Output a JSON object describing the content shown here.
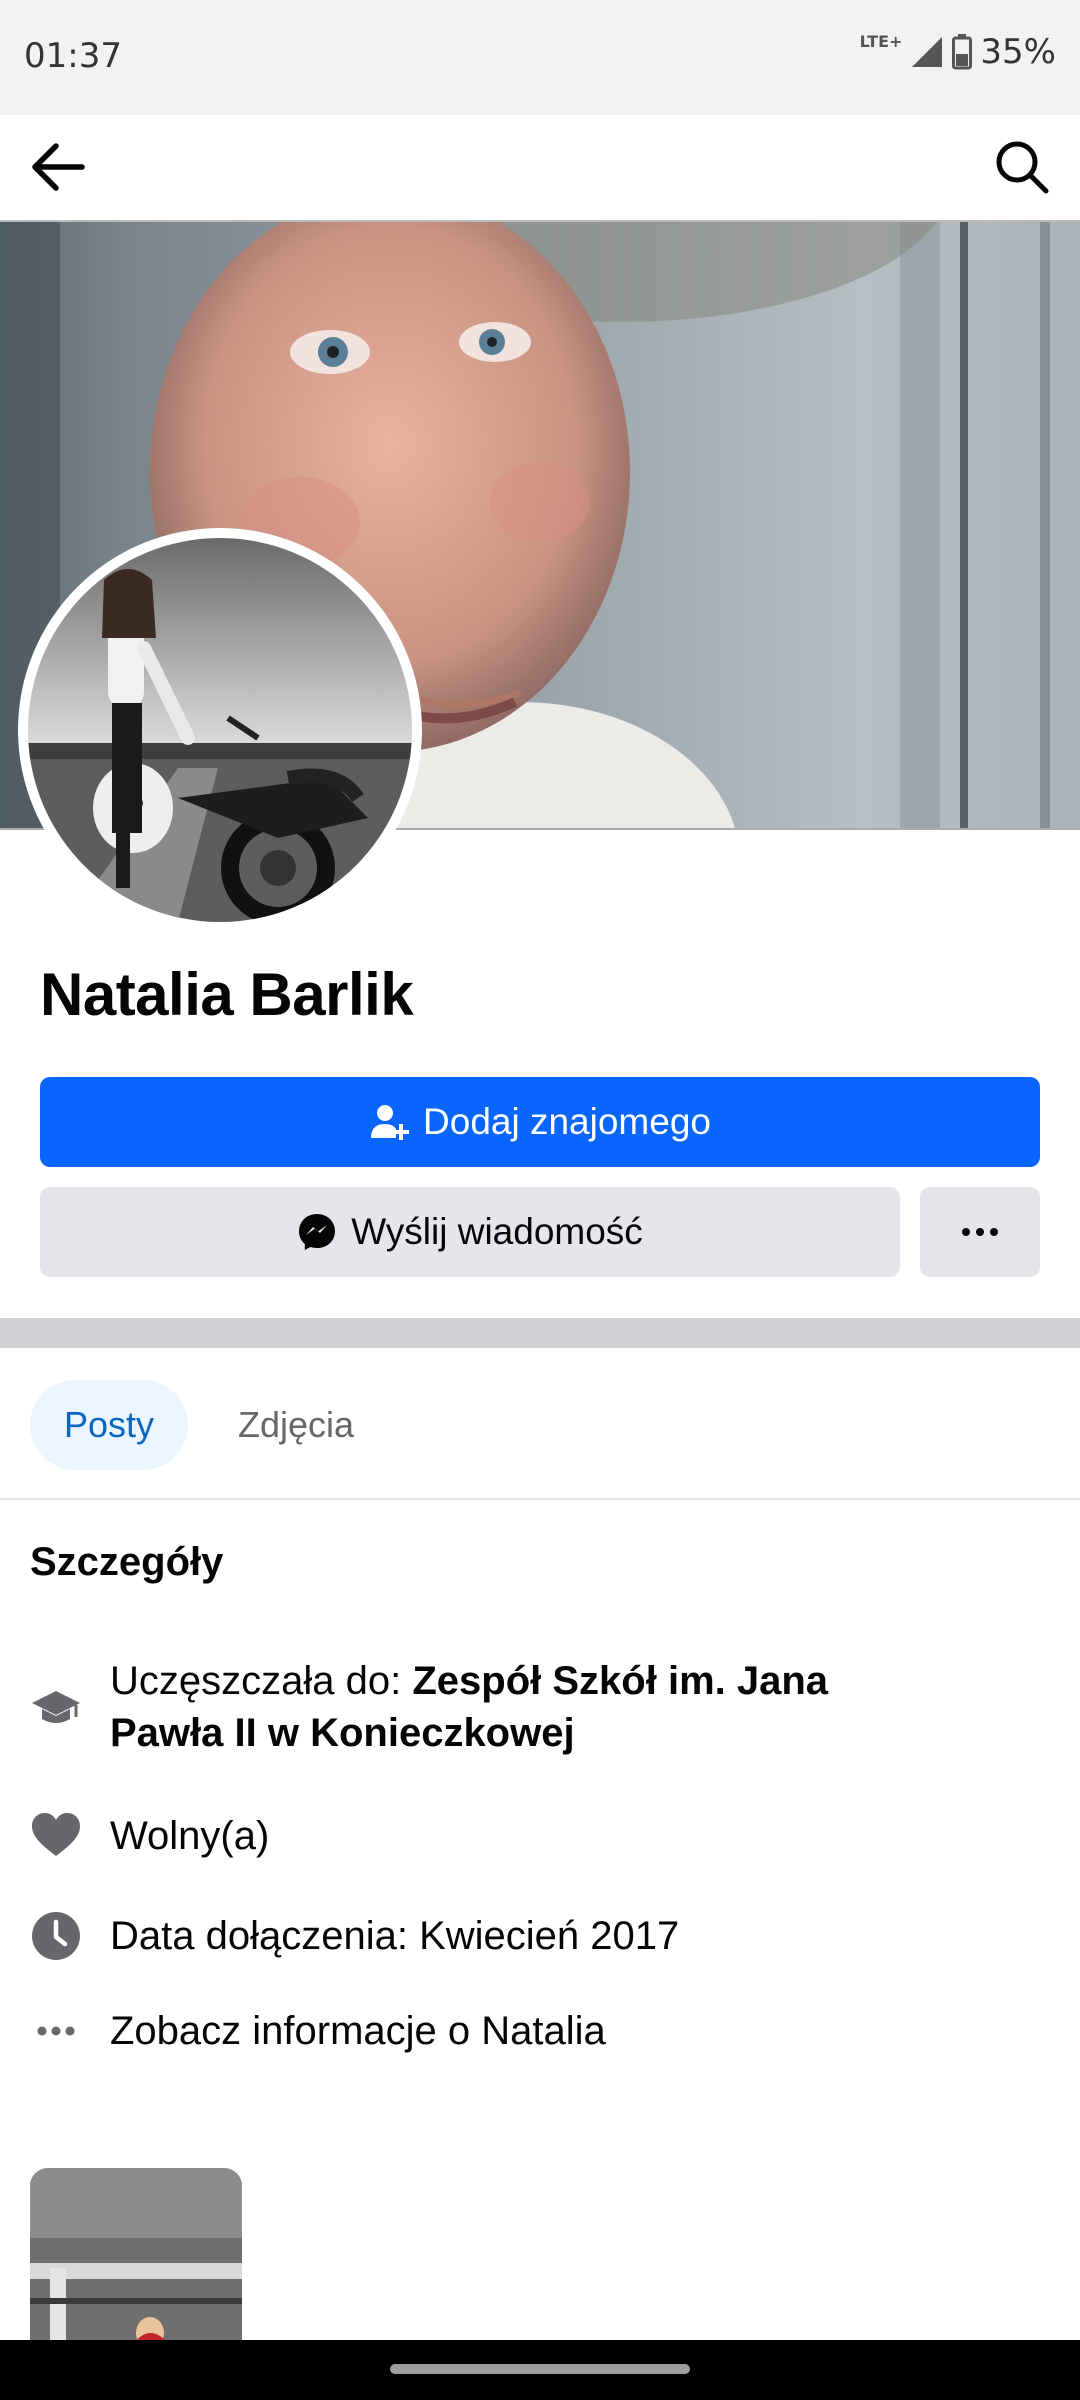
{
  "status_bar": {
    "time": "01:37",
    "network": "LTE+",
    "battery": "35%"
  },
  "header": {
    "back_icon": "arrow-left-icon",
    "search_icon": "search-icon"
  },
  "profile": {
    "name": "Natalia Barlik"
  },
  "actions": {
    "add_friend": "Dodaj znajomego",
    "send_message": "Wyślij wiadomość",
    "more_icon": "more-horizontal-icon"
  },
  "tabs": {
    "posts": "Posty",
    "photos": "Zdjęcia"
  },
  "details": {
    "title": "Szczegóły",
    "school_prefix": "Uczęszczała do: ",
    "school_name_line1": "Zespół Szkół im. Jana",
    "school_name_line2": "Pawła II w Konieczkowej",
    "relationship": "Wolny(a)",
    "joined": "Data dołączenia: Kwiecień 2017",
    "see_more": "Zobacz informacje o Natalia"
  },
  "colors": {
    "accent": "#0866ff",
    "secondary_button": "#e4e6eb",
    "tab_active_bg": "#ebf5ff",
    "tab_active_text": "#0a66c2"
  }
}
